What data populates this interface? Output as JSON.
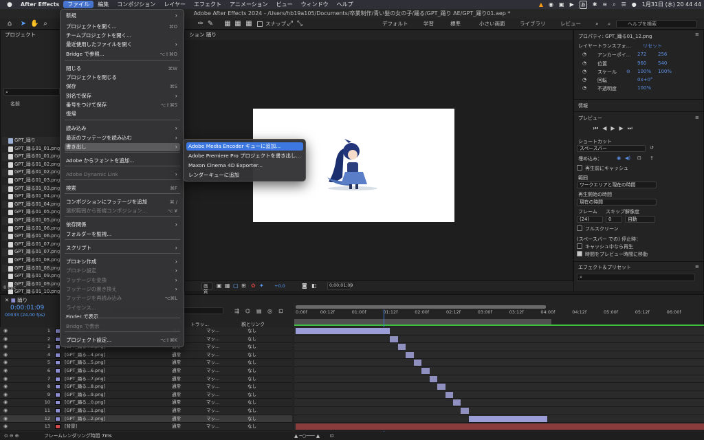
{
  "menubar": {
    "apple": "",
    "app": "After Effects",
    "items": [
      "ファイル",
      "編集",
      "コンポジション",
      "レイヤー",
      "エフェクト",
      "アニメーション",
      "ビュー",
      "ウィンドウ",
      "ヘルプ"
    ],
    "ime": "あ",
    "clock": "1月31日 (水)  20 44 44"
  },
  "window_title": "Adobe After Effects 2024 - /Users/hb19a105/Documents/卒業制作/青い髪の女の子/踊る/GPT_踊り AE/GPT_踊り01.aep *",
  "toolbar": {
    "snap_label": "スナップ",
    "workspaces": [
      "デフォルト",
      "学習",
      "標準",
      "小さい画面",
      "ライブラリ",
      "レビュー"
    ],
    "search_help": "ヘルプを検索"
  },
  "project_panel": {
    "title": "プロジェクト",
    "col_name": "名前",
    "files": [
      "GPT_踊り",
      "GPT_踊る01_01.png",
      "GPT_踊る01_01.png",
      "GPT_踊る01_02.png",
      "GPT_踊る01_02.png",
      "GPT_踊る01_03.png",
      "GPT_踊る01_03.png",
      "GPT_踊る01_04.png",
      "GPT_踊る01_04.png",
      "GPT_踊る01_05.png",
      "GPT_踊る01_05.png",
      "GPT_踊る01_06.png",
      "GPT_踊る01_06.png",
      "GPT_踊る01_07.png",
      "GPT_踊る01_07.png",
      "GPT_踊る01_08.png",
      "GPT_踊る01_08.png",
      "GPT_踊る01_09.png",
      "GPT_踊る01_09.png",
      "GPT_踊る01_10.png",
      "GPT_踊る01_10.png",
      "GPT_踊る01_11.png"
    ],
    "bpc": "8 bpc"
  },
  "comp_panel": {
    "tab": "ション 踊り",
    "zoom_label": "画質",
    "exposure": "+0.0",
    "timecode": "0;00;01;09"
  },
  "file_menu": {
    "items": [
      {
        "label": "新規",
        "arrow": "›"
      },
      {
        "label": "プロジェクトを開く...",
        "sc": "⌘O"
      },
      {
        "label": "チームプロジェクトを開く..."
      },
      {
        "label": "最近使用したファイルを開く",
        "arrow": "›"
      },
      {
        "label": "Bridge で参照...",
        "sc": "⌥⇧⌘O"
      },
      {
        "label": "閉じる",
        "sc": "⌘W"
      },
      {
        "label": "プロジェクトを閉じる"
      },
      {
        "label": "保存",
        "sc": "⌘S"
      },
      {
        "label": "別名で保存",
        "arrow": "›"
      },
      {
        "label": "番号をつけて保存",
        "sc": "⌥⇧⌘S"
      },
      {
        "label": "復帰"
      },
      {
        "label": "読み込み",
        "arrow": "›"
      },
      {
        "label": "最近のフッテージを読み込む",
        "arrow": "›"
      },
      {
        "label": "書き出し",
        "arrow": "›"
      },
      {
        "label": "Adobe からフォントを追加..."
      },
      {
        "label": "Adobe Dynamic Link",
        "arrow": "›"
      },
      {
        "label": "検索",
        "sc": "⌘F"
      },
      {
        "label": "コンポジションにフッテージを追加",
        "sc": "⌘ /"
      },
      {
        "label": "選択範囲から新規コンポジション...",
        "sc": "⌥ ¥"
      },
      {
        "label": "依存関係",
        "arrow": "›"
      },
      {
        "label": "フォルダーを監視..."
      },
      {
        "label": "スクリプト",
        "arrow": "›"
      },
      {
        "label": "プロキシ作成",
        "arrow": "›"
      },
      {
        "label": "プロキシ設定",
        "arrow": "›"
      },
      {
        "label": "フッテージを変換",
        "arrow": "›"
      },
      {
        "label": "フッテージの置き換え",
        "arrow": "›"
      },
      {
        "label": "フッテージを再読み込み",
        "sc": "⌥⌘L"
      },
      {
        "label": "ライセンス..."
      },
      {
        "label": "Finder で表示"
      },
      {
        "label": "Bridge で表示"
      },
      {
        "label": "プロジェクト設定...",
        "sc": "⌥⇧⌘K"
      }
    ]
  },
  "export_submenu": {
    "items": [
      "Adobe Media Encoder キューに追加...",
      "Adobe Premiere Pro プロジェクトを書き出し...",
      "Maxon Cinema 4D Exporter...",
      "レンダーキューに追加"
    ]
  },
  "properties": {
    "title": "プロパティ: GPT_踊る01_12.png",
    "section": "レイヤートランスフォ...",
    "reset": "リセット",
    "anchor_label": "アンカーポイ...",
    "anchor_x": "272",
    "anchor_y": "256",
    "position_label": "位置",
    "position_x": "960",
    "position_y": "540",
    "scale_label": "スケール",
    "scale_x": "100%",
    "scale_y": "100%",
    "rotation_label": "回転",
    "rotation": "0x+0°",
    "opacity_label": "不透明度",
    "opacity": "100%"
  },
  "info_panel": {
    "title": "情報"
  },
  "preview": {
    "title": "プレビュー",
    "shortcut_label": "ショートカット",
    "shortcut_value": "スペースバー",
    "include_label": "埋め込み：",
    "cache_before": "再生前にキャッシュ",
    "range_label": "範囲",
    "range_value": "ワークエリアと現在の時間",
    "start_label": "再生開始の時間",
    "start_value": "現在の時間",
    "frame_label": "フレーム",
    "skip_label": "スキップ",
    "res_label": "解像度",
    "frame_value": "(24)",
    "skip_value": "0",
    "res_value": "自動",
    "fullscreen": "フルスクリーン",
    "stop_label": "(スペースバー での) 停止時：",
    "cache_playing": "キャッシュ中なら再生",
    "move_time": "時間をプレビュー時間に移動"
  },
  "effects": {
    "title": "エフェクト＆プリセット"
  },
  "timeline": {
    "tab": "踊り",
    "timecode": "0:00:01:09",
    "frame_info": "00033 (24.00 fps)",
    "headers": {
      "mode": "モード",
      "t": "T",
      "trkmat": "トラッ...",
      "parent": "親とリンク"
    },
    "ticks": [
      "0:00f",
      "00:12f",
      "01:00f",
      "01:12f",
      "02:00f",
      "02:12f",
      "03:00f",
      "03:12f",
      "04:00f",
      "04:12f",
      "05:00f",
      "05:12f",
      "06:00f"
    ],
    "layers": [
      {
        "num": "1",
        "name": "[GPT_踊る...1.png]",
        "mode": "通常",
        "trk": "マッ...",
        "parent": "なし"
      },
      {
        "num": "2",
        "name": "[GPT_踊る...2.png]",
        "mode": "通常",
        "trk": "マッ...",
        "parent": "なし"
      },
      {
        "num": "3",
        "name": "[GPT_踊る...3.png]",
        "mode": "通常",
        "trk": "マッ...",
        "parent": "なし"
      },
      {
        "num": "4",
        "name": "[GPT_踊る...4.png]",
        "mode": "通常",
        "trk": "マッ...",
        "parent": "なし"
      },
      {
        "num": "5",
        "name": "[GPT_踊る...5.png]",
        "mode": "通常",
        "trk": "マッ...",
        "parent": "なし"
      },
      {
        "num": "6",
        "name": "[GPT_踊る...6.png]",
        "mode": "通常",
        "trk": "マッ...",
        "parent": "なし"
      },
      {
        "num": "7",
        "name": "[GPT_踊る...7.png]",
        "mode": "通常",
        "trk": "マッ...",
        "parent": "なし"
      },
      {
        "num": "8",
        "name": "[GPT_踊る...8.png]",
        "mode": "通常",
        "trk": "マッ...",
        "parent": "なし"
      },
      {
        "num": "9",
        "name": "[GPT_踊る...9.png]",
        "mode": "通常",
        "trk": "マッ...",
        "parent": "なし"
      },
      {
        "num": "10",
        "name": "[GPT_踊る...0.png]",
        "mode": "通常",
        "trk": "マッ...",
        "parent": "なし"
      },
      {
        "num": "11",
        "name": "[GPT_踊る...1.png]",
        "mode": "通常",
        "trk": "マッ...",
        "parent": "なし"
      },
      {
        "num": "12",
        "name": "[GPT_踊る...2.png]",
        "mode": "通常",
        "trk": "マッ...",
        "parent": "なし"
      },
      {
        "num": "13",
        "name": "[背景]",
        "mode": "通常",
        "trk": "マッ...",
        "parent": "なし"
      }
    ]
  },
  "status": {
    "render_label": "フレームレンダリング時間",
    "render_value": "7ms"
  },
  "colors": {
    "accent": "#3d78e0",
    "layer_label": "#8e8fd1",
    "bg_layer": "#d24b4b",
    "timecode": "#5aa0ff"
  }
}
